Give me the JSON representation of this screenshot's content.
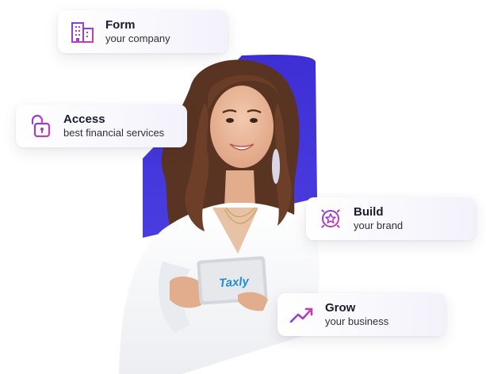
{
  "colors": {
    "accent_blue": "#4435d8",
    "icon_gradient_start": "#7b3fe4",
    "icon_gradient_end": "#d43fa8",
    "tablet_logo": "#1e8fd6"
  },
  "cards": [
    {
      "id": "form",
      "icon": "building-icon",
      "title": "Form",
      "subtitle": "your company"
    },
    {
      "id": "access",
      "icon": "lock-icon",
      "title": "Access",
      "subtitle": "best financial services"
    },
    {
      "id": "build",
      "icon": "star-badge-icon",
      "title": "Build",
      "subtitle": "your brand"
    },
    {
      "id": "grow",
      "icon": "trend-up-icon",
      "title": "Grow",
      "subtitle": "your business"
    }
  ],
  "tablet": {
    "logo_text": "Taxly"
  }
}
